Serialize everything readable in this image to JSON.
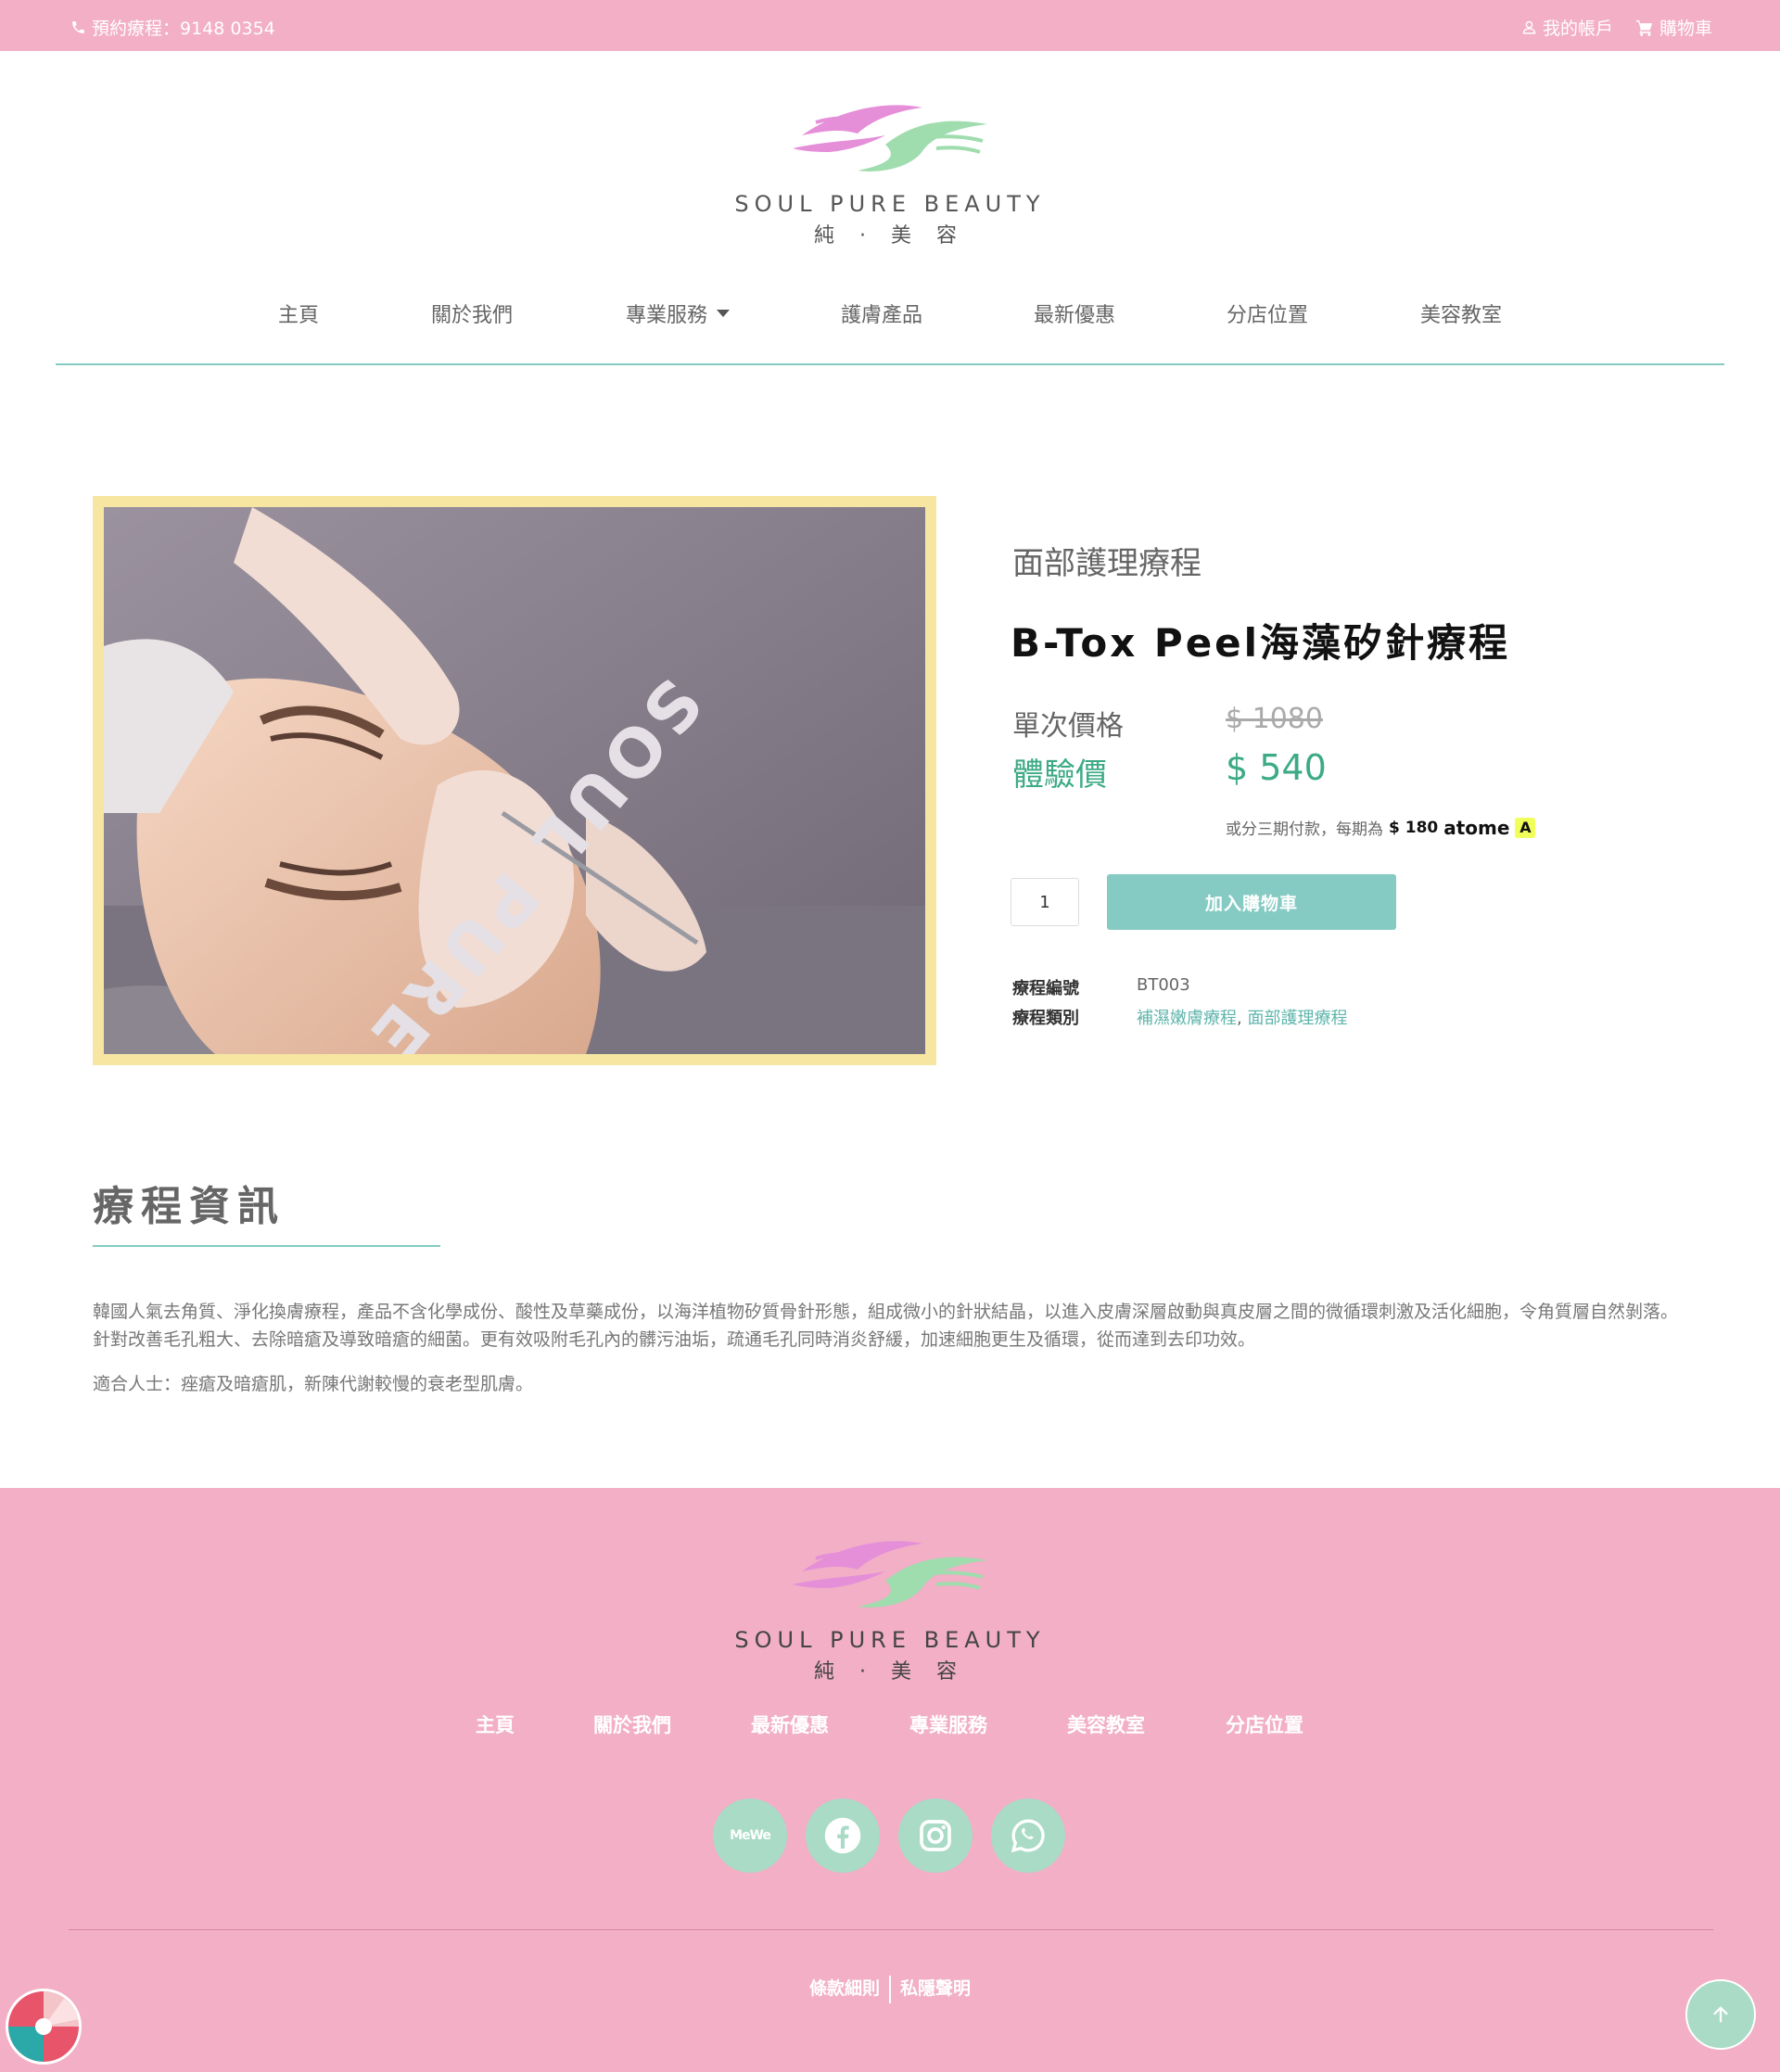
{
  "topbar": {
    "phone": "預約療程：9148 0354",
    "account": "我的帳戶",
    "cart": "購物車"
  },
  "brand": {
    "name_en": "SOUL PURE BEAUTY",
    "name_zh": "純 · 美 容"
  },
  "nav": {
    "items": [
      "主頁",
      "關於我們",
      "專業服務",
      "護膚產品",
      "最新優惠",
      "分店位置",
      "美容教室"
    ]
  },
  "product": {
    "category": "面部護理療程",
    "title": "B-Tox Peel海藻矽針療程",
    "single_price_label": "單次價格",
    "single_price": "$ 1080",
    "trial_price_label": "體驗價",
    "trial_price": "$ 540",
    "installment_text": "或分三期付款，每期為",
    "installment_amount": "$ 180",
    "installment_brand": "atome",
    "quantity": "1",
    "add_to_cart": "加入購物車",
    "sku_label": "療程編號",
    "sku": "BT003",
    "category_label": "療程類別",
    "category_link_1": "補濕嫩膚療程",
    "category_sep": ",",
    "category_link_2": "面部護理療程"
  },
  "photo": {
    "towel_text": "SOUL PURE"
  },
  "info": {
    "title": "療程資訊",
    "paragraph_1": "韓國人氣去角質、淨化換膚療程，產品不含化學成份、酸性及草藥成份，以海洋植物矽質骨針形態，組成微小的針狀結晶，以進入皮膚深層啟動與真皮層之間的微循環刺激及活化細胞，令角質層自然剝落。針對改善毛孔粗大、去除暗瘡及導致暗瘡的細菌。更有效吸附毛孔內的髒污油垢，疏通毛孔同時消炎舒緩，加速細胞更生及循環，從而達到去印功效。",
    "paragraph_2": "適合人士：痤瘡及暗瘡肌，新陳代謝較慢的衰老型肌膚。"
  },
  "footer": {
    "nav": [
      "主頁",
      "關於我們",
      "最新優惠",
      "專業服務",
      "美容教室",
      "分店位置"
    ],
    "social": {
      "mewe": "MeWe",
      "icons": [
        "facebook-icon",
        "instagram-icon",
        "whatsapp-icon"
      ]
    },
    "terms": "條款細則",
    "privacy": "私隱聲明"
  },
  "colors": {
    "pink": "#f2afc6",
    "teal": "#86cbc3",
    "green_price": "#3daa86",
    "mint": "#a9dbc7",
    "frame": "#f6e6a2"
  }
}
